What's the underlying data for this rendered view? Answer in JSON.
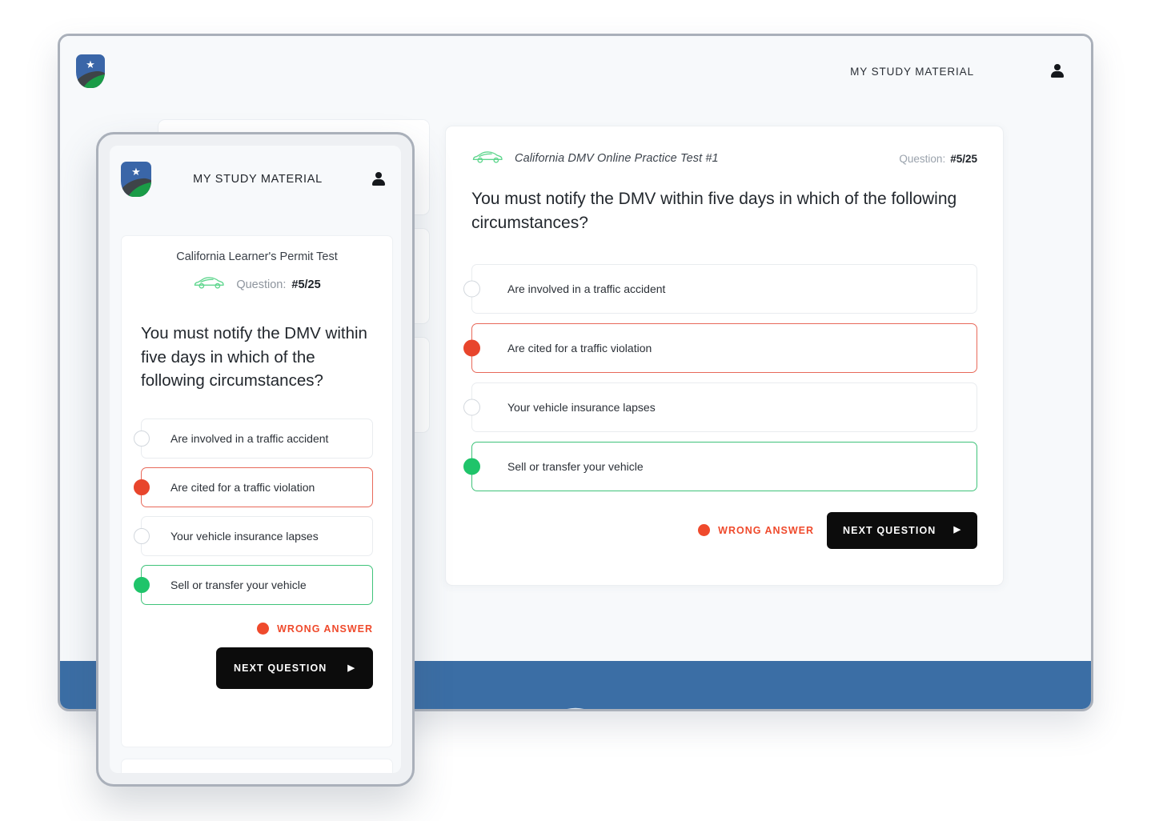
{
  "desktop": {
    "header": {
      "logo_icon": "shield-star-logo",
      "nav_label": "MY STUDY MATERIAL",
      "account_icon": "person-icon"
    },
    "quiz": {
      "vehicle_icon": "car-icon",
      "test_title": "California DMV Online Practice Test #1",
      "question_label": "Question:",
      "question_counter": "#5/25",
      "question_text": "You must notify the DMV within five days in which of the following circumstances?",
      "options": [
        {
          "label": "Are involved in a traffic accident",
          "state": "neutral"
        },
        {
          "label": "Are cited for a traffic violation",
          "state": "wrong"
        },
        {
          "label": "Your vehicle insurance lapses",
          "state": "neutral"
        },
        {
          "label": "Sell or transfer your vehicle",
          "state": "correct"
        }
      ],
      "verdict_text": "WRONG ANSWER",
      "next_button_label": "NEXT QUESTION",
      "next_button_caret": "▶"
    }
  },
  "mobile": {
    "header": {
      "logo_icon": "shield-star-logo",
      "nav_label": "MY STUDY MATERIAL",
      "account_icon": "person-icon"
    },
    "quiz": {
      "test_title": "California Learner's Permit Test",
      "vehicle_icon": "car-icon",
      "question_label": "Question:",
      "question_counter": "#5/25",
      "question_text": "You must notify the DMV within five days in which of the following circumstances?",
      "options": [
        {
          "label": "Are involved in a traffic accident",
          "state": "neutral"
        },
        {
          "label": "Are cited for a traffic violation",
          "state": "wrong"
        },
        {
          "label": "Your vehicle insurance lapses",
          "state": "neutral"
        },
        {
          "label": "Sell or transfer your vehicle",
          "state": "correct"
        }
      ],
      "verdict_text": "WRONG ANSWER",
      "next_button_label": "NEXT QUESTION",
      "next_button_caret": "▶"
    }
  },
  "colors": {
    "wrong": "#ef4a2c",
    "correct": "#1fc46a",
    "accent_blue": "#3b6ea5",
    "button_dark": "#0c0c0c",
    "page_bg": "#f7f9fb"
  }
}
